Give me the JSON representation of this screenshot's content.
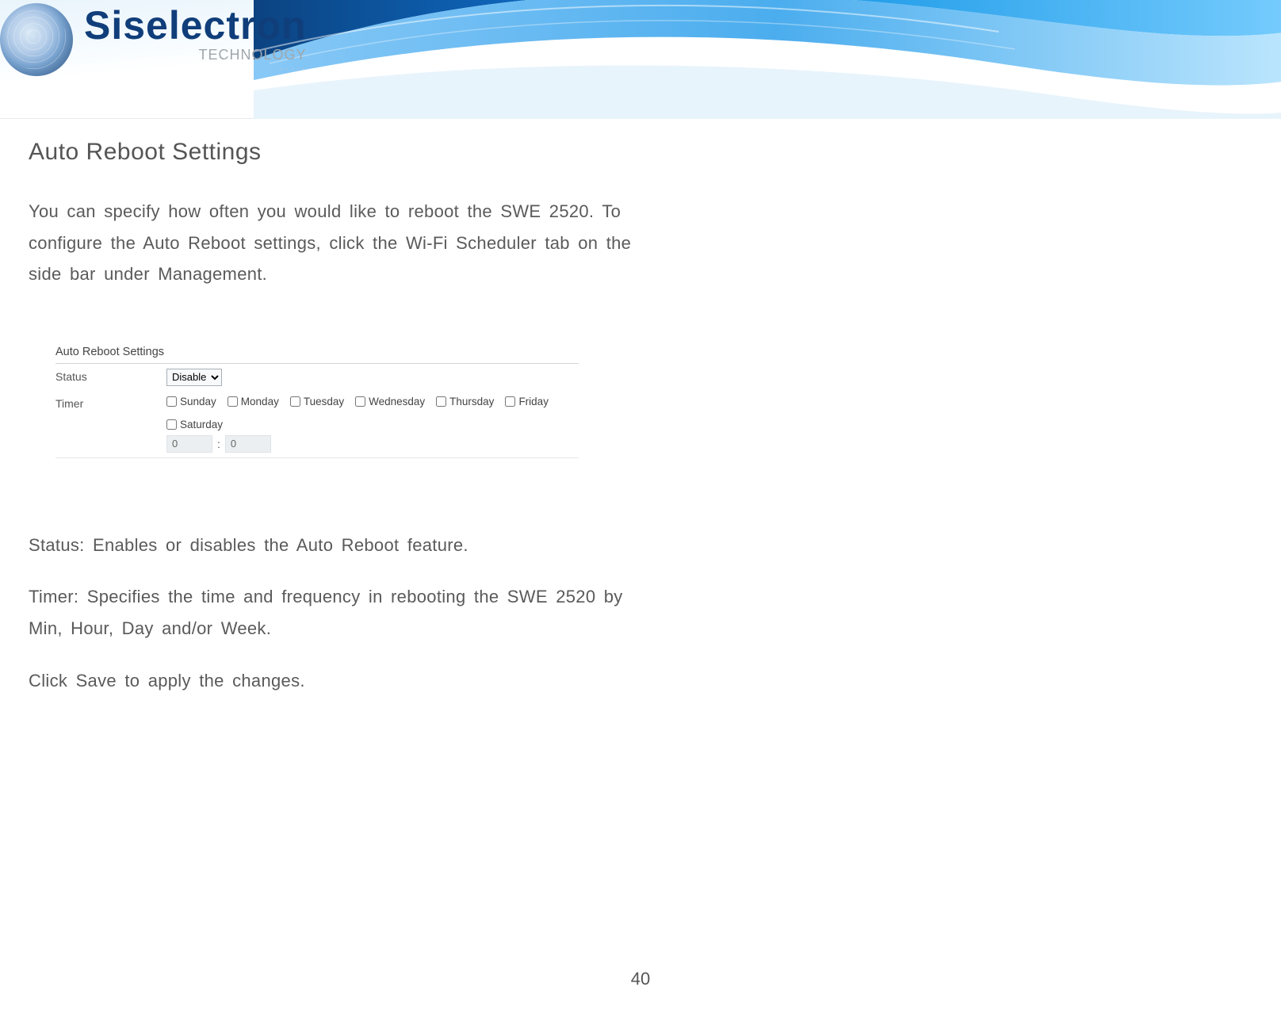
{
  "brand": {
    "name": "Siselectron",
    "sub": "TECHNOLOGY",
    "dots": "·····"
  },
  "title": "Auto  Reboot Settings",
  "intro": "You  can   specify   how  often  you   would   like   to   reboot the   SWE 2520.   To  configure   the   Auto  Reboot   settings,  click   the    Wi-Fi Scheduler   tab   on   the   side   bar   under Management.",
  "panel": {
    "title": "Auto Reboot Settings",
    "status_label": "Status",
    "timer_label": "Timer",
    "status_value": "Disable",
    "days": [
      "Sunday",
      "Monday",
      "Tuesday",
      "Wednesday",
      "Thursday",
      "Friday",
      "Saturday"
    ],
    "hour": "0",
    "minute": "0"
  },
  "desc_status": "Status: Enables  or disables  the  Auto  Reboot  feature.",
  "desc_timer": "Timer:  Specifies   the   time   and   frequency  in  rebooting the   SWE 2520   by Min, Hour, Day and/or  Week.",
  "desc_save": "Click Save  to  apply  the  changes.",
  "page_number": "40"
}
